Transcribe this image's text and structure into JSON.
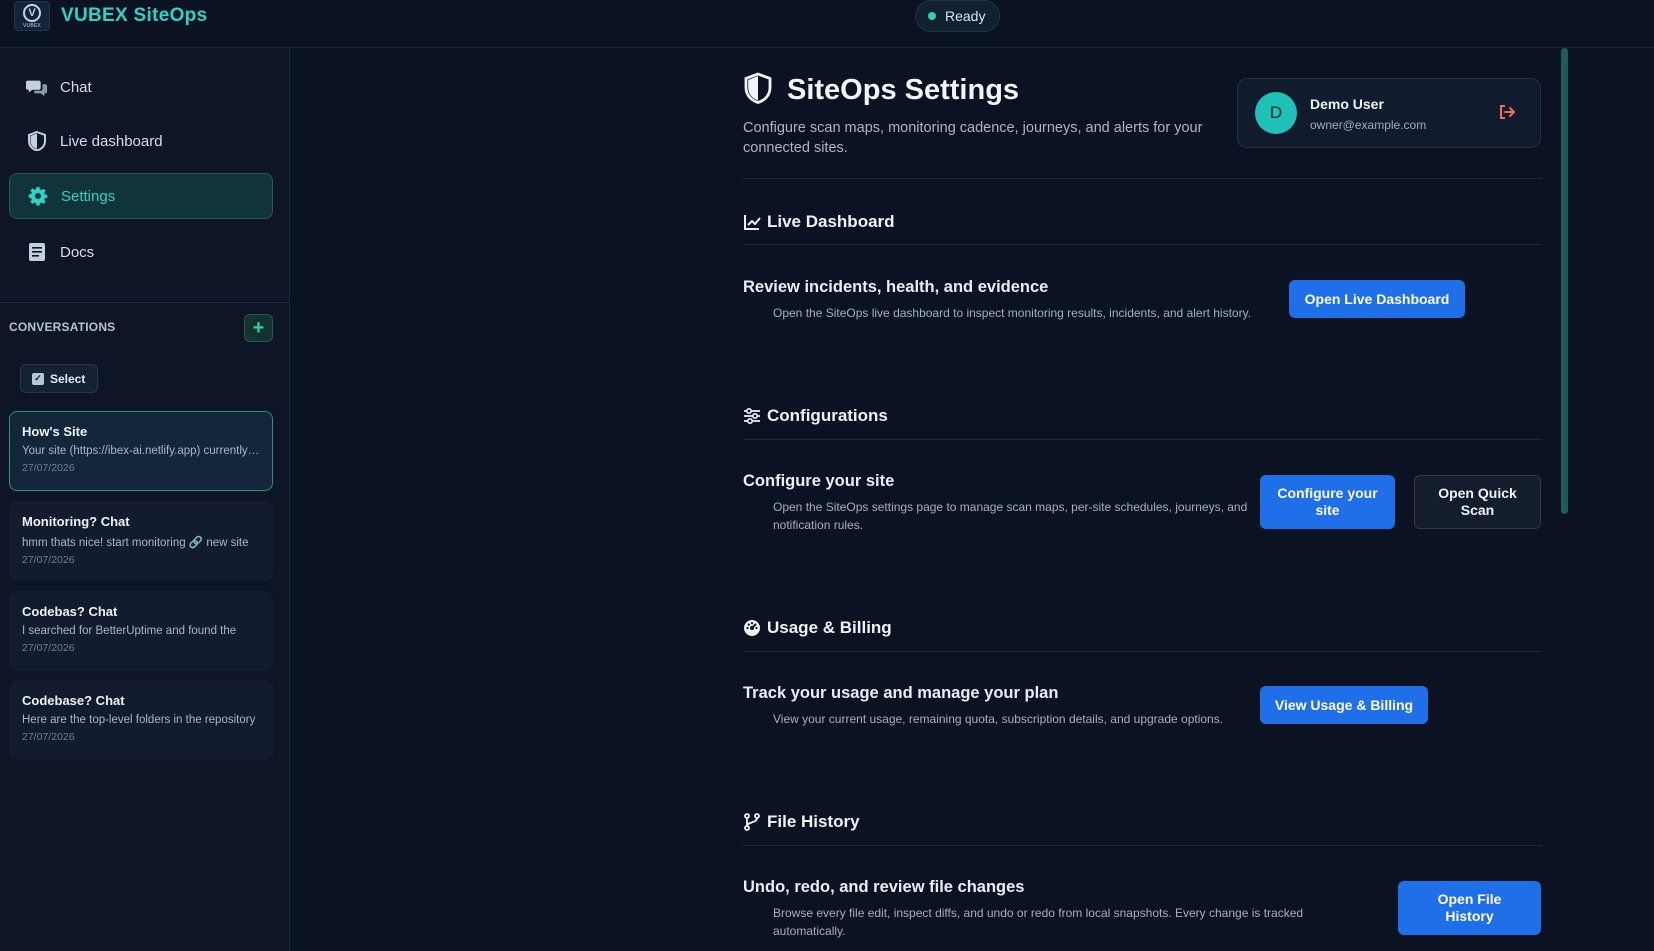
{
  "app": {
    "logo_text": "VUBEX",
    "brand": "VUBEX SiteOps",
    "status": "Ready"
  },
  "sidebar": {
    "nav": [
      {
        "label": "Chat",
        "icon": "chat-bubbles-icon",
        "active": false
      },
      {
        "label": "Live dashboard",
        "icon": "shield-icon",
        "active": false
      },
      {
        "label": "Settings",
        "icon": "gear-icon",
        "active": true
      },
      {
        "label": "Docs",
        "icon": "book-icon",
        "active": false
      }
    ],
    "conversations_title": "CONVERSATIONS",
    "add_label": "+",
    "select_label": "Select",
    "conversations": [
      {
        "title": "How's Site",
        "preview": "Your site (https://ibex-ai.netlify.app) currently looks healthy",
        "date": "27/07/2026",
        "active": true
      },
      {
        "title": "Monitoring? Chat",
        "preview": "hmm thats nice! start monitoring 🔗 new site",
        "date": "27/07/2026",
        "active": false
      },
      {
        "title": "Codebas? Chat",
        "preview": "I searched for BetterUptime and found the",
        "date": "27/07/2026",
        "active": false
      },
      {
        "title": "Codebase? Chat",
        "preview": "Here are the top-level folders in the repository",
        "date": "27/07/2026",
        "active": false
      }
    ]
  },
  "header": {
    "title": "SiteOps Settings",
    "subtitle": "Configure scan maps, monitoring cadence, journeys, and alerts for your connected sites."
  },
  "user": {
    "initial": "D",
    "name": "Demo User",
    "email": "owner@example.com"
  },
  "sections": {
    "live": {
      "heading": "Live Dashboard",
      "title": "Review incidents, health, and evidence",
      "desc": "Open the SiteOps live dashboard to inspect monitoring results, incidents, and alert history.",
      "button": "Open Live Dashboard"
    },
    "config": {
      "heading": "Configurations",
      "title": "Configure your site",
      "desc": "Open the SiteOps settings page to manage scan maps, per-site schedules, journeys, and notification rules.",
      "button_primary": "Configure your site",
      "button_secondary": "Open Quick Scan"
    },
    "billing": {
      "heading": "Usage & Billing",
      "title": "Track your usage and manage your plan",
      "desc": "View your current usage, remaining quota, subscription details, and upgrade options.",
      "button": "View Usage & Billing"
    },
    "history": {
      "heading": "File History",
      "title": "Undo, redo, and review file changes",
      "desc": "Browse every file edit, inspect diffs, and undo or redo from local snapshots. Every change is tracked automatically.",
      "button": "Open File History"
    }
  },
  "colors": {
    "accent": "#2dd4c4",
    "primary_button": "#1f6fe8",
    "background": "#0b1222"
  }
}
